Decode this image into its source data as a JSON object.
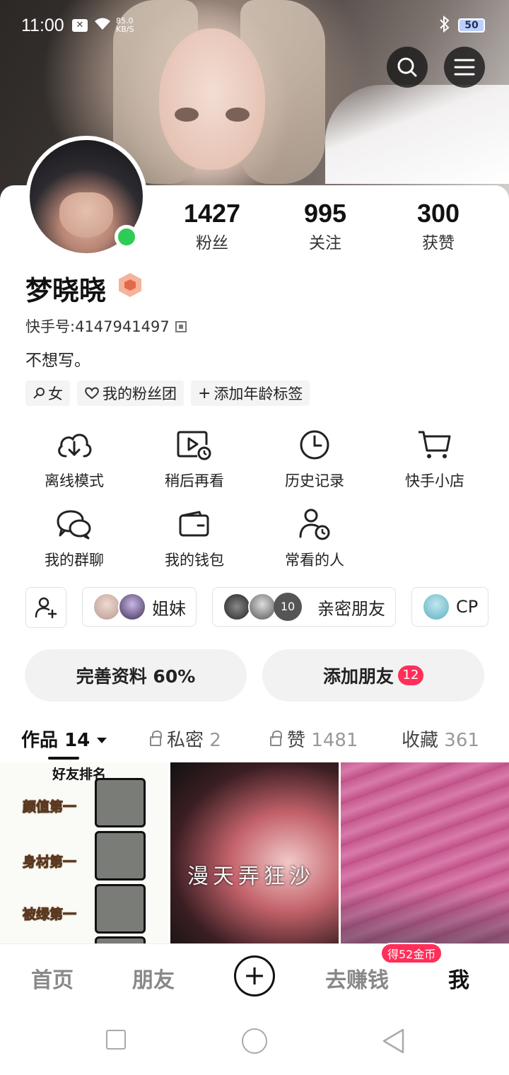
{
  "status_bar": {
    "time": "11:00",
    "net_speed_value": "85.0",
    "net_speed_unit": "KB/S",
    "battery": "50"
  },
  "header": {
    "search_icon": "search-icon",
    "menu_icon": "hamburger-menu-icon"
  },
  "profile": {
    "name": "梦晓晓",
    "kuaishou_id_label": "快手号:",
    "kuaishou_id": "4147941497",
    "bio": "不想写。",
    "online_color": "#2ecc55",
    "stats": [
      {
        "value": "1427",
        "label": "粉丝"
      },
      {
        "value": "995",
        "label": "关注"
      },
      {
        "value": "300",
        "label": "获赞"
      }
    ],
    "tags": [
      "女",
      "我的粉丝团",
      "添加年龄标签"
    ]
  },
  "menu": {
    "row1": [
      {
        "label": "离线模式",
        "icon": "download-cloud-icon"
      },
      {
        "label": "稍后再看",
        "icon": "watch-later-icon"
      },
      {
        "label": "历史记录",
        "icon": "clock-icon"
      },
      {
        "label": "快手小店",
        "icon": "cart-icon"
      }
    ],
    "row2": [
      {
        "label": "我的群聊",
        "icon": "chat-bubbles-icon"
      },
      {
        "label": "我的钱包",
        "icon": "wallet-icon"
      },
      {
        "label": "常看的人",
        "icon": "person-clock-icon"
      }
    ]
  },
  "groups": [
    {
      "name": "姐妹"
    },
    {
      "name": "亲密朋友",
      "count": "10"
    },
    {
      "name": "CP"
    }
  ],
  "actions": {
    "complete_profile": "完善资料 60%",
    "add_friends": "添加朋友",
    "add_friends_badge": "12"
  },
  "tabs": {
    "works_label": "作品",
    "works_count": "14",
    "private_label": "私密",
    "private_count": "2",
    "liked_label": "赞",
    "liked_count": "1481",
    "saved_label": "收藏",
    "saved_count": "361"
  },
  "works": {
    "w1_title": "好友排名",
    "w1_labels": [
      "颜值第一",
      "身材第一",
      "被绿第一"
    ],
    "w2_caption": "漫天弄狂沙"
  },
  "bottom_nav": {
    "home": "首页",
    "friends": "朋友",
    "earn": "去赚钱",
    "earn_badge": "得52金币",
    "me": "我"
  },
  "accent_color": "#ff2f5a"
}
